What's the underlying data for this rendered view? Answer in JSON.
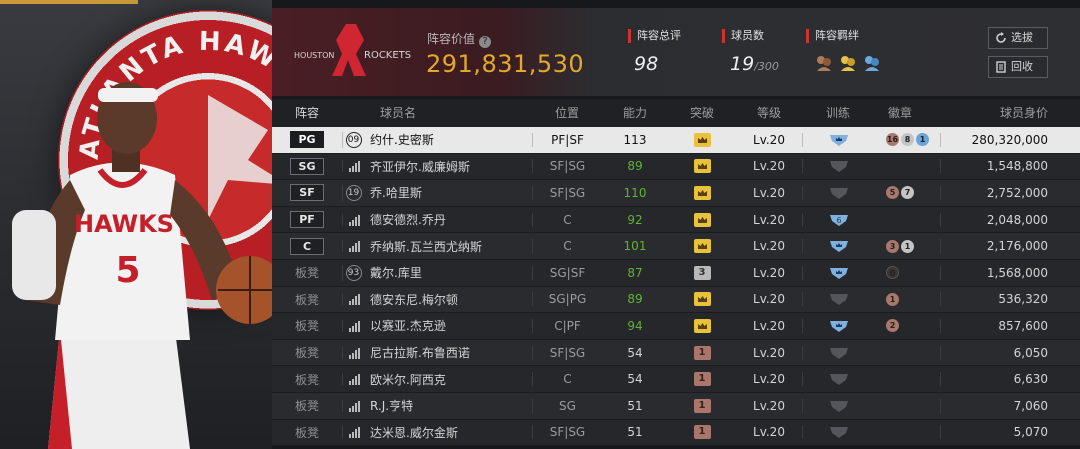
{
  "team": {
    "logo_text": "ROCKETS",
    "logo_sub": "HOUSTON"
  },
  "hero": {
    "logo_text": "ATLANTA HAWKS",
    "jersey_team": "HAWKS",
    "jersey_number": "5"
  },
  "lineup_value": {
    "label": "阵容价值",
    "value": "291,831,530",
    "help_icon": "?"
  },
  "stats": [
    {
      "label": "阵容总评",
      "value": "98",
      "suffix": ""
    },
    {
      "label": "球员数",
      "value": "19",
      "suffix": "/300"
    },
    {
      "label": "阵容羁绊",
      "value": "",
      "suffix": ""
    }
  ],
  "bond_icons": [
    "bond-bronze-icon",
    "bond-gold-icon",
    "bond-blue-icon"
  ],
  "buttons": {
    "select": "选拔",
    "recycle": "回收"
  },
  "columns": [
    "阵容",
    "球员名",
    "位置",
    "能力",
    "突破",
    "等级",
    "训练",
    "徽章",
    "球员身价"
  ],
  "rows": [
    {
      "slot": "PG",
      "bench": false,
      "num": "09",
      "name": "约什.史密斯",
      "role": "PF|SF",
      "ability": "113",
      "green": false,
      "breakthrough": "gold",
      "brk_num": "",
      "level": "Lv.20",
      "train": "shield-blue-crown",
      "train_num": "",
      "medals": [
        {
          "t": "bronze",
          "n": "16"
        },
        {
          "t": "silver",
          "n": "8"
        },
        {
          "t": "blue",
          "n": "1"
        }
      ],
      "price": "280,320,000",
      "selected": true,
      "icon": "num"
    },
    {
      "slot": "SG",
      "bench": false,
      "num": "",
      "name": "齐亚伊尔.威廉姆斯",
      "role": "SF|SG",
      "ability": "89",
      "green": true,
      "breakthrough": "gold",
      "brk_num": "",
      "level": "Lv.20",
      "train": "shield-gray",
      "train_num": "",
      "medals": [],
      "price": "1,548,800",
      "selected": false,
      "icon": "bars"
    },
    {
      "slot": "SF",
      "bench": false,
      "num": "19",
      "name": "乔.哈里斯",
      "role": "SF|SG",
      "ability": "110",
      "green": true,
      "breakthrough": "gold",
      "brk_num": "",
      "level": "Lv.20",
      "train": "shield-gray",
      "train_num": "",
      "medals": [
        {
          "t": "bronze",
          "n": "5"
        },
        {
          "t": "silver",
          "n": "7"
        }
      ],
      "price": "2,752,000",
      "selected": false,
      "icon": "num"
    },
    {
      "slot": "PF",
      "bench": false,
      "num": "",
      "name": "德安德烈.乔丹",
      "role": "C",
      "ability": "92",
      "green": true,
      "breakthrough": "gold",
      "brk_num": "",
      "level": "Lv.20",
      "train": "shield-blue",
      "train_num": "6",
      "medals": [],
      "price": "2,048,000",
      "selected": false,
      "icon": "bars"
    },
    {
      "slot": "C",
      "bench": false,
      "num": "",
      "name": "乔纳斯.瓦兰西尤纳斯",
      "role": "C",
      "ability": "101",
      "green": true,
      "breakthrough": "gold",
      "brk_num": "",
      "level": "Lv.20",
      "train": "shield-blue-crown",
      "train_num": "",
      "medals": [
        {
          "t": "bronze",
          "n": "3"
        },
        {
          "t": "silver",
          "n": "1"
        }
      ],
      "price": "2,176,000",
      "selected": false,
      "icon": "bars"
    },
    {
      "slot": "板凳",
      "bench": true,
      "num": "93",
      "name": "戴尔.库里",
      "role": "SG|SF",
      "ability": "87",
      "green": true,
      "breakthrough": "silver",
      "brk_num": "3",
      "level": "Lv.20",
      "train": "shield-blue-crown",
      "train_num": "",
      "medals": [
        {
          "t": "dark",
          "n": "0"
        }
      ],
      "price": "1,568,000",
      "selected": false,
      "icon": "num"
    },
    {
      "slot": "板凳",
      "bench": true,
      "num": "",
      "name": "德安东尼.梅尔顿",
      "role": "SG|PG",
      "ability": "89",
      "green": true,
      "breakthrough": "gold",
      "brk_num": "",
      "level": "Lv.20",
      "train": "shield-gray",
      "train_num": "",
      "medals": [
        {
          "t": "bronze",
          "n": "1"
        }
      ],
      "price": "536,320",
      "selected": false,
      "icon": "bars"
    },
    {
      "slot": "板凳",
      "bench": true,
      "num": "",
      "name": "以赛亚.杰克逊",
      "role": "C|PF",
      "ability": "94",
      "green": true,
      "breakthrough": "gold",
      "brk_num": "",
      "level": "Lv.20",
      "train": "shield-blue-crown",
      "train_num": "",
      "medals": [
        {
          "t": "bronze",
          "n": "2"
        }
      ],
      "price": "857,600",
      "selected": false,
      "icon": "bars"
    },
    {
      "slot": "板凳",
      "bench": true,
      "num": "",
      "name": "尼古拉斯.布鲁西诺",
      "role": "SF|SG",
      "ability": "54",
      "green": false,
      "breakthrough": "bronze",
      "brk_num": "1",
      "level": "Lv.20",
      "train": "shield-gray",
      "train_num": "",
      "medals": [],
      "price": "6,050",
      "selected": false,
      "icon": "bars"
    },
    {
      "slot": "板凳",
      "bench": true,
      "num": "",
      "name": "欧米尔.阿西克",
      "role": "C",
      "ability": "54",
      "green": false,
      "breakthrough": "bronze",
      "brk_num": "1",
      "level": "Lv.20",
      "train": "shield-gray",
      "train_num": "",
      "medals": [],
      "price": "6,630",
      "selected": false,
      "icon": "bars"
    },
    {
      "slot": "板凳",
      "bench": true,
      "num": "",
      "name": "R.J.亨特",
      "role": "SG",
      "ability": "51",
      "green": false,
      "breakthrough": "bronze",
      "brk_num": "1",
      "level": "Lv.20",
      "train": "shield-gray",
      "train_num": "",
      "medals": [],
      "price": "7,060",
      "selected": false,
      "icon": "bars"
    },
    {
      "slot": "板凳",
      "bench": true,
      "num": "",
      "name": "达米恩.威尔金斯",
      "role": "SF|SG",
      "ability": "51",
      "green": false,
      "breakthrough": "bronze",
      "brk_num": "1",
      "level": "Lv.20",
      "train": "shield-gray",
      "train_num": "",
      "medals": [],
      "price": "5,070",
      "selected": false,
      "icon": "bars"
    }
  ],
  "colors": {
    "accent_gold": "#e2a92a",
    "tag_red": "#d0322d",
    "ability_green": "#5fb52f"
  }
}
